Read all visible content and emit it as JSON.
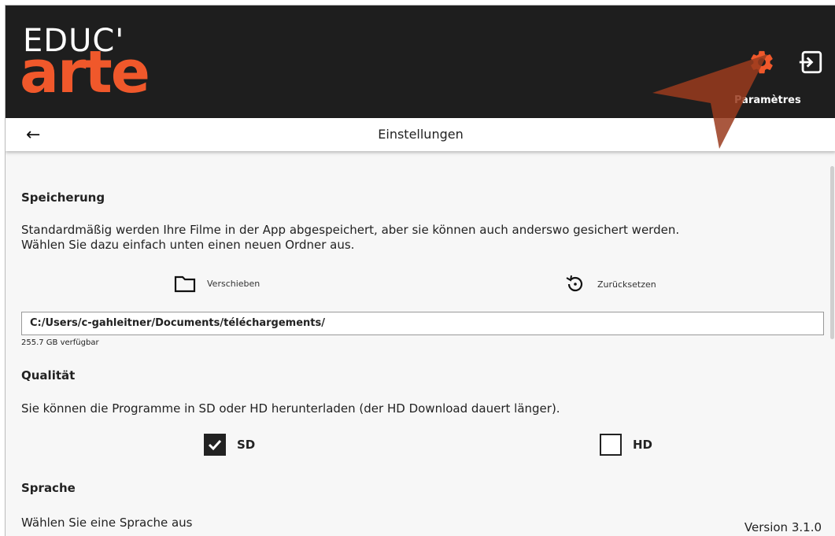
{
  "header": {
    "logo_top": "EDUC'",
    "logo_bottom": "arte",
    "settings_icon": "gear-icon",
    "logout_icon": "logout-icon",
    "settings_tooltip": "Paramètres",
    "accent_color": "#f0582b"
  },
  "titlebar": {
    "back_icon": "arrow-left-icon",
    "back_glyph": "←",
    "title": "Einstellungen"
  },
  "storage": {
    "heading": "Speicherung",
    "description_line1": "Standardmäßig werden Ihre Filme in der App abgespeichert, aber sie können auch anderswo gesichert werden.",
    "description_line2": "Wählen Sie dazu einfach unten einen neuen Ordner aus.",
    "move_label": "Verschieben",
    "move_icon": "folder-icon",
    "reset_label": "Zurücksetzen",
    "reset_icon": "reset-icon",
    "path": "C:/Users/c-gahleitner/Documents/téléchargements/",
    "available": "255.7 GB verfügbar"
  },
  "quality": {
    "heading": "Qualität",
    "description": "Sie können die Programme in SD oder HD herunterladen (der HD Download dauert länger).",
    "options": [
      {
        "label": "SD",
        "checked": true
      },
      {
        "label": "HD",
        "checked": false
      }
    ]
  },
  "language": {
    "heading": "Sprache",
    "description": "Wählen Sie eine Sprache aus"
  },
  "version": "Version 3.1.0"
}
